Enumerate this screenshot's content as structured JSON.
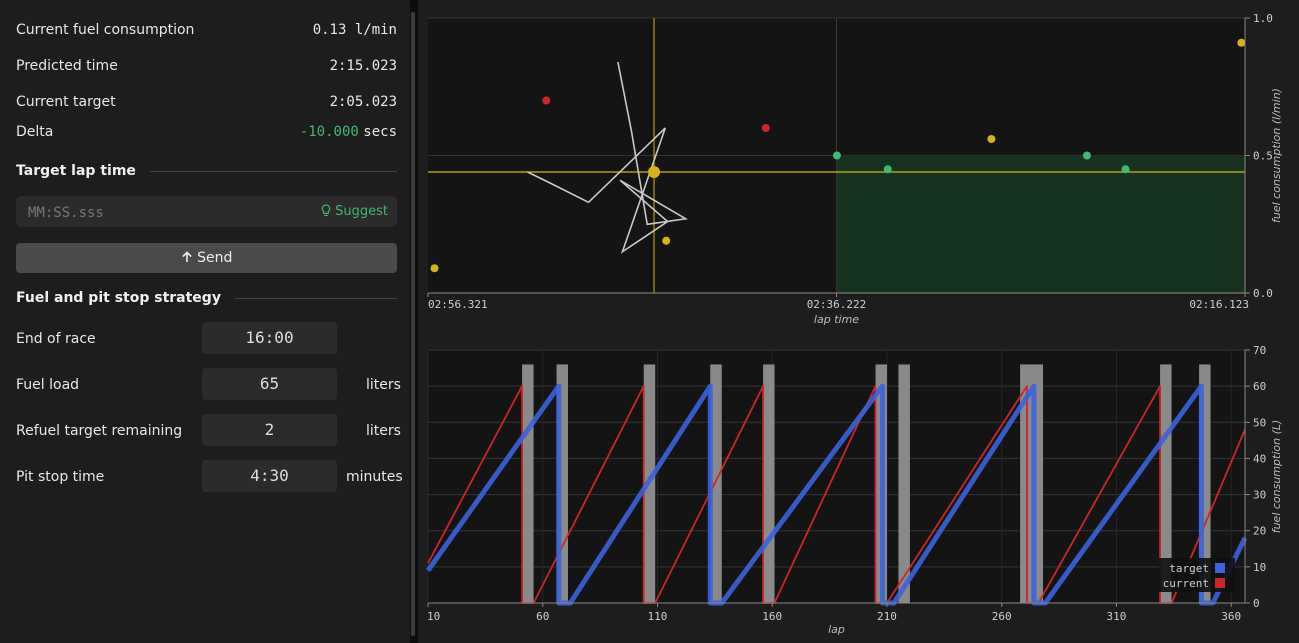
{
  "stats": [
    {
      "label": "Current fuel consumption",
      "value": "0.13 l/min"
    },
    {
      "label": "Predicted time",
      "value": "2:15.023"
    },
    {
      "label": "Current target",
      "value": "2:05.023"
    }
  ],
  "delta": {
    "label": "Delta",
    "value": "-10.000",
    "unit": "secs"
  },
  "target_section": {
    "title": "Target lap time",
    "placeholder": "MM:SS.sss",
    "suggest_label": "Suggest",
    "send_label": "Send"
  },
  "strategy": {
    "title": "Fuel and pit stop strategy",
    "end_of_race": {
      "label": "End of race",
      "value": "16:00"
    },
    "fuel_load": {
      "label": "Fuel load",
      "value": "65",
      "unit": "liters"
    },
    "refuel_target": {
      "label": "Refuel target remaining",
      "value": "2",
      "unit": "liters"
    },
    "pit_stop_time": {
      "label": "Pit stop time",
      "value": "4:30",
      "unit": "minutes"
    }
  },
  "colors": {
    "green": "#3fb872",
    "yellow": "#d6b31a",
    "red": "#d12525",
    "blue": "#3a63dc",
    "panel": "#1d1d1d"
  },
  "chart_data": [
    {
      "type": "scatter",
      "xlabel": "lap time",
      "ylabel": "fuel consumption (l/min)",
      "xtick_labels": [
        "02:56.321",
        "02:36.222",
        "02:16.123"
      ],
      "ytick_labels": [
        "0.0",
        "0.5",
        "1.0"
      ],
      "ylim": [
        0,
        1
      ],
      "target_band": {
        "x_from": "02:36.222",
        "y_max": 0.5
      },
      "crosshair": {
        "x": "02:45.2",
        "y": 0.44
      },
      "points": [
        {
          "x": "02:56.0",
          "y": 0.09,
          "color": "yellow"
        },
        {
          "x": "02:50.5",
          "y": 0.7,
          "color": "red"
        },
        {
          "x": "02:44.6",
          "y": 0.19,
          "color": "yellow"
        },
        {
          "x": "02:39.7",
          "y": 0.6,
          "color": "red"
        },
        {
          "x": "02:36.2",
          "y": 0.5,
          "color": "green"
        },
        {
          "x": "02:33.7",
          "y": 0.45,
          "color": "green"
        },
        {
          "x": "02:28.6",
          "y": 0.56,
          "color": "yellow"
        },
        {
          "x": "02:23.9",
          "y": 0.5,
          "color": "green"
        },
        {
          "x": "02:22.0",
          "y": 0.45,
          "color": "green"
        },
        {
          "x": "02:16.3",
          "y": 0.91,
          "color": "yellow"
        }
      ],
      "trail": [
        [
          0.84,
          0.84
        ],
        [
          0.9,
          0.59
        ],
        [
          0.97,
          0.25
        ],
        [
          1.14,
          0.27
        ],
        [
          0.85,
          0.41
        ],
        [
          1.06,
          0.26
        ],
        [
          0.86,
          0.15
        ],
        [
          1.05,
          0.6
        ],
        [
          0.71,
          0.33
        ],
        [
          0.54,
          0.4
        ],
        [
          0.44,
          0.44
        ]
      ]
    },
    {
      "type": "line",
      "xlabel": "lap",
      "ylabel": "fuel consumption (L)",
      "x_ticks": [
        10,
        60,
        110,
        160,
        210,
        260,
        310,
        360
      ],
      "y_ticks": [
        0,
        10,
        20,
        30,
        40,
        50,
        60,
        70
      ],
      "ylim": [
        0,
        70
      ],
      "series": [
        {
          "name": "target",
          "color": "blue",
          "points": [
            [
              10,
              9
            ],
            [
              67,
              60
            ],
            [
              67,
              0
            ],
            [
              72,
              0
            ],
            [
              133,
              60
            ],
            [
              133,
              0
            ],
            [
              138,
              0
            ],
            [
              208,
              60
            ],
            [
              208,
              0
            ],
            [
              213,
              0
            ],
            [
              274,
              60
            ],
            [
              274,
              0
            ],
            [
              279,
              0
            ],
            [
              347,
              60
            ],
            [
              347,
              0
            ],
            [
              352,
              0
            ],
            [
              366,
              18
            ]
          ]
        },
        {
          "name": "current",
          "color": "red",
          "points": [
            [
              10,
              11
            ],
            [
              51,
              60
            ],
            [
              51,
              0
            ],
            [
              56,
              0
            ],
            [
              104,
              60
            ],
            [
              104,
              0
            ],
            [
              109,
              0
            ],
            [
              156,
              60
            ],
            [
              156,
              0
            ],
            [
              161,
              0
            ],
            [
              205,
              60
            ],
            [
              205,
              0
            ],
            [
              210,
              0
            ],
            [
              271,
              60
            ],
            [
              271,
              0
            ],
            [
              276,
              0
            ],
            [
              329,
              60
            ],
            [
              329,
              0
            ],
            [
              334,
              0
            ],
            [
              366,
              48
            ]
          ]
        }
      ],
      "pit_stops": [
        [
          51,
          56
        ],
        [
          66,
          71
        ],
        [
          104,
          109
        ],
        [
          133,
          138
        ],
        [
          156,
          161
        ],
        [
          205,
          210
        ],
        [
          215,
          220
        ],
        [
          268,
          278
        ],
        [
          329,
          334
        ],
        [
          346,
          351
        ]
      ]
    }
  ]
}
